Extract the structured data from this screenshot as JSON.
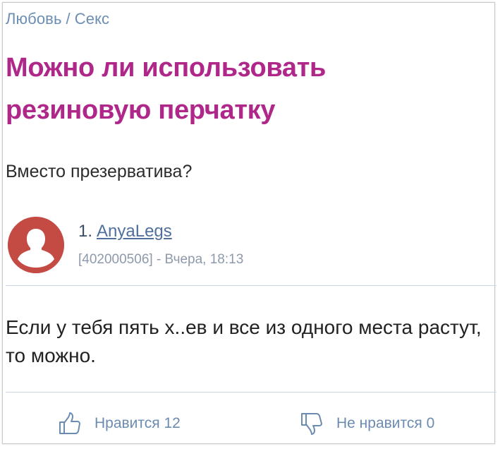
{
  "breadcrumb": {
    "category": "Любовь",
    "separator": "/",
    "subcategory": "Секс"
  },
  "question": {
    "title": "Можно ли использовать резиновую перчатку",
    "text": "Вместо презерватива?"
  },
  "answer": {
    "number": "1.",
    "username": "AnyaLegs",
    "meta": "[402000506] - Вчера, 18:13",
    "text": "Если у тебя пять х..ев и все из одного места растут, то можно.",
    "avatar_icon": "user-silhouette-icon",
    "avatar_color": "#c44b44"
  },
  "votes": {
    "like_label": "Нравится 12",
    "dislike_label": "Не нравится 0",
    "like_icon": "thumbs-up-icon",
    "dislike_icon": "thumbs-down-icon"
  },
  "colors": {
    "title": "#b0278a",
    "link": "#4f6f9d",
    "accent": "#6c8bb1"
  }
}
